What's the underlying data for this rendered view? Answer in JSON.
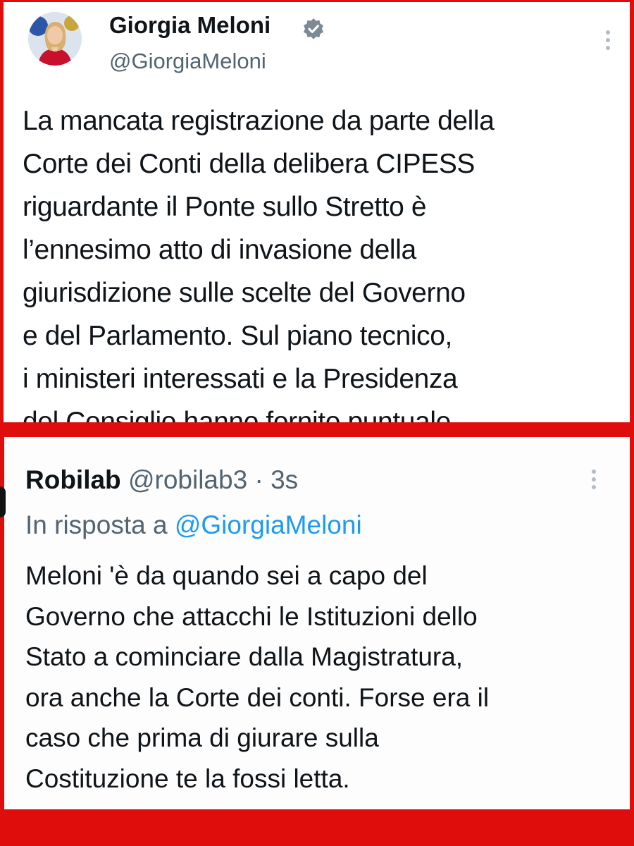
{
  "original_tweet": {
    "author_name": "Giorgia Meloni",
    "author_handle": "@GiorgiaMeloni",
    "text_lines": [
      "La mancata registrazione da parte della",
      "Corte dei Conti della delibera CIPESS",
      "riguardante il Ponte sullo Stretto è",
      "l’ennesimo atto di invasione della",
      "giurisdizione sulle scelte del Governo",
      "e del Parlamento. Sul piano tecnico,",
      "i ministeri interessati e la Presidenza",
      "del Consiglio hanno fornito puntuale"
    ]
  },
  "reply_tweet": {
    "author_name": "Robilab",
    "author_handle": "@robilab3",
    "separator": " · ",
    "timestamp": "3s",
    "reply_prefix": "In risposta a ",
    "reply_mention": "@GiorgiaMeloni",
    "text_lines": [
      "Meloni 'è da quando sei a capo del",
      "Governo che attacchi le Istituzioni dello",
      "Stato a cominciare dalla Magistratura,",
      "ora anche la Corte dei conti. Forse era il",
      "caso che prima di giurare sulla",
      "Costituzione te la fossi letta."
    ]
  },
  "colors": {
    "frame": "#e00d0d",
    "text": "#0f1419",
    "secondary_text": "#536471",
    "link": "#1d9bf0"
  }
}
